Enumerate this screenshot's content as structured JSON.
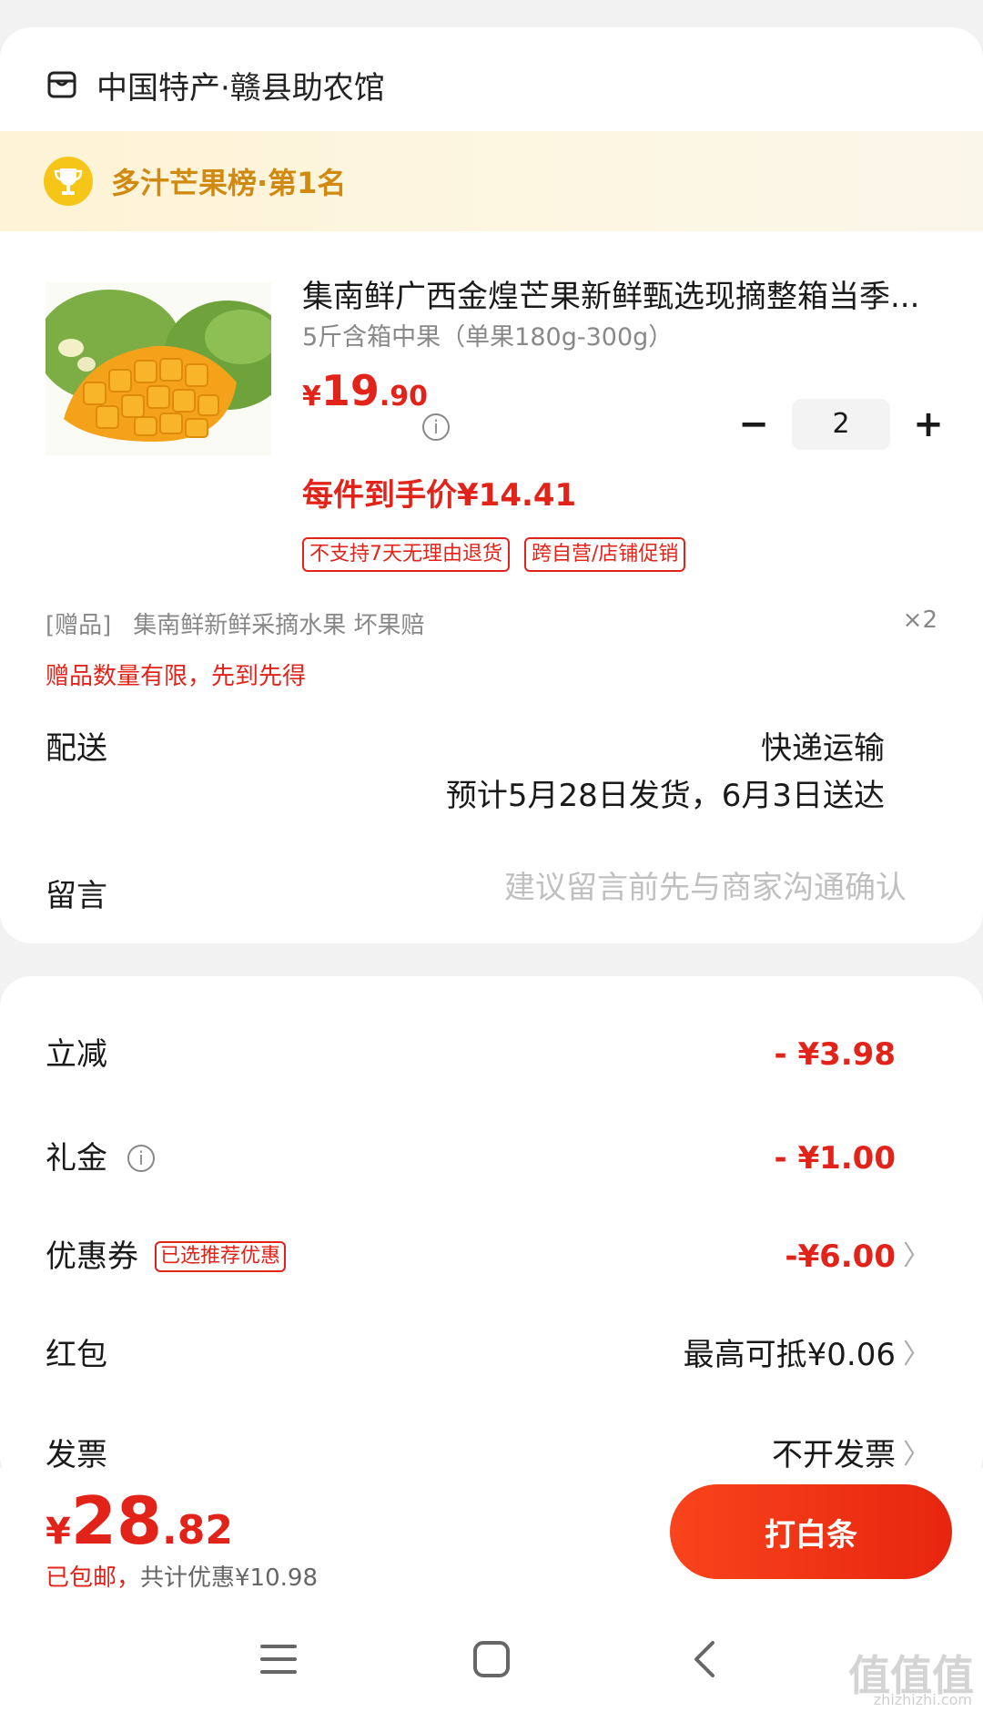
{
  "shop": {
    "name": "中国特产·赣县助农馆",
    "icon": "shop-icon"
  },
  "ranking": {
    "text": "多汁芒果榜·第1名",
    "icon": "trophy-icon"
  },
  "product": {
    "title": "集南鲜广西金煌芒果新鲜甄选现摘整箱当季...",
    "spec": "5斤含箱中果（单果180g-300g）",
    "price_symbol": "¥",
    "price_int": "19",
    "price_dec": ".90",
    "info_icon": "i",
    "quantity": "2",
    "minus": "−",
    "plus": "+",
    "deal_price": "每件到手价¥14.41",
    "tags": [
      "不支持7天无理由退货",
      "跨自营/店铺促销"
    ],
    "image": "mango-image"
  },
  "gift": {
    "prefix": "[赠品]",
    "name": "集南鲜新鲜采摘水果 坏果赔",
    "qty": "×2",
    "warning": "赠品数量有限，先到先得"
  },
  "shipping": {
    "label": "配送",
    "type": "快递运输",
    "date": "预计5月28日发货，6月3日送达"
  },
  "message": {
    "label": "留言",
    "placeholder": "建议留言前先与商家沟通确认"
  },
  "discounts": {
    "instant": {
      "label": "立减",
      "value": "- ¥3.98"
    },
    "gift_money": {
      "label": "礼金",
      "value": "- ¥1.00",
      "info_icon": "i"
    },
    "coupon": {
      "label": "优惠券",
      "badge": "已选推荐优惠",
      "value": "-¥6.00",
      "chevron": "〉"
    },
    "red_packet": {
      "label": "红包",
      "value": "最高可抵¥0.06",
      "chevron": "〉"
    },
    "invoice": {
      "label": "发票",
      "value": "不开发票",
      "chevron": "〉"
    }
  },
  "footer": {
    "total_symbol": "¥",
    "total_int": "28",
    "total_dec": ".82",
    "free_shipping": "已包邮，",
    "saving": "共计优惠¥10.98",
    "pay_button": "打白条"
  },
  "watermark": {
    "main": "值值值",
    "sub": "zhizhizhi.com"
  },
  "colors": {
    "accent_red": "#e2231a",
    "gold": "#d08a12",
    "button_red": "#f9441c"
  }
}
